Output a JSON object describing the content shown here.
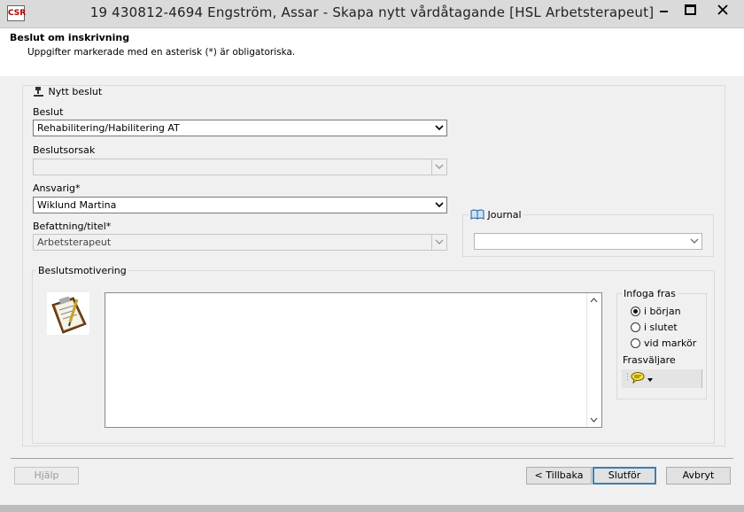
{
  "window": {
    "title": "19 430812-4694   Engström, Assar   -   Skapa nytt vårdåtagande   [HSL Arbetsterapeut]",
    "app_icon_text": "CSR"
  },
  "header": {
    "title": "Beslut om inskrivning",
    "subtitle": "Uppgifter markerade med en asterisk (*) är obligatoriska."
  },
  "group": {
    "title": "Nytt beslut"
  },
  "form": {
    "beslut_label": "Beslut",
    "beslut_value": "Rehabilitering/Habilitering AT",
    "beslutsorsak_label": "Beslutsorsak",
    "beslutsorsak_value": "",
    "ansvarig_label": "Ansvarig*",
    "ansvarig_value": "Wiklund Martina",
    "befattning_label": "Befattning/titel*",
    "befattning_value": "Arbetsterapeut"
  },
  "journal": {
    "label": "Journal",
    "value": ""
  },
  "motivering": {
    "label": "Beslutsmotivering",
    "text": ""
  },
  "infoga": {
    "title": "Infoga fras",
    "options": [
      "i början",
      "i slutet",
      "vid markör"
    ],
    "selected": "i början",
    "fras_label": "Frasväljare"
  },
  "buttons": {
    "help": "Hjälp",
    "back": "< Tillbaka",
    "finish": "Slutför",
    "cancel": "Avbryt"
  }
}
